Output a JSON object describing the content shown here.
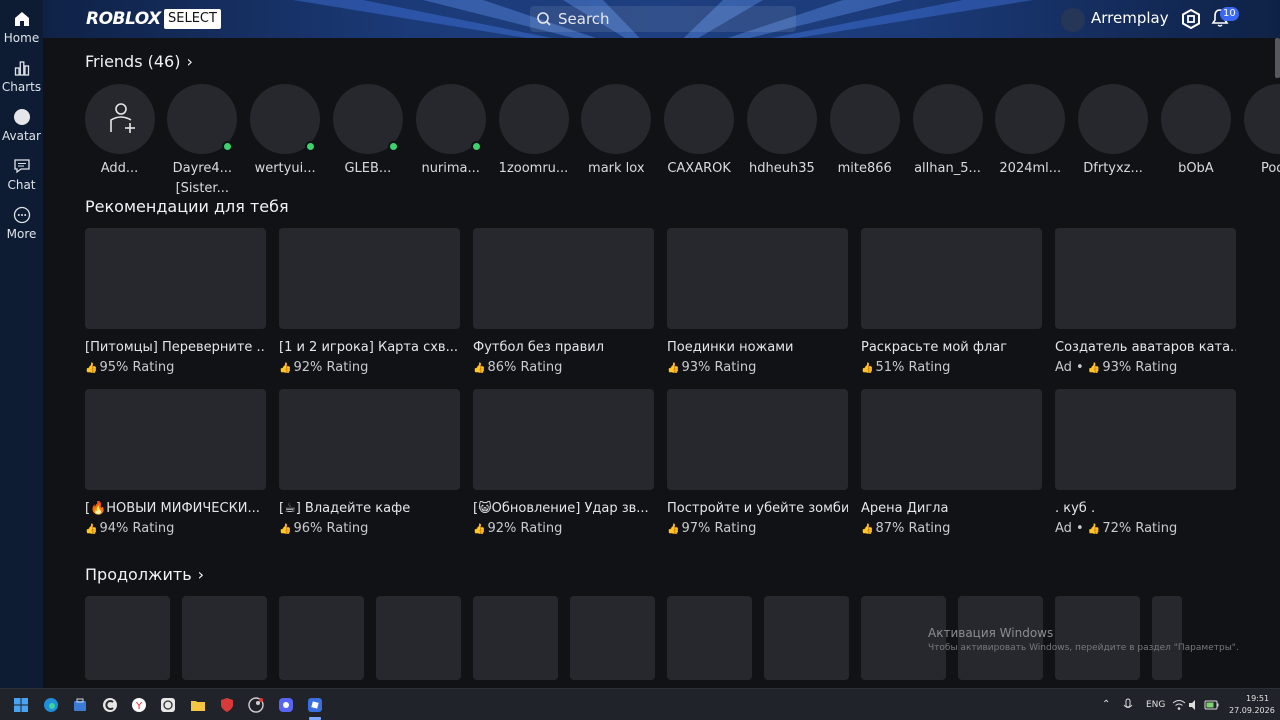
{
  "topbar": {
    "logo": "ROBLOX",
    "logo_badge": "SELECT",
    "search_label": "Search",
    "username": "Arremplay",
    "notifications_count": "10"
  },
  "sidebar": {
    "items": [
      {
        "label": "Home",
        "icon": "home-icon"
      },
      {
        "label": "Charts",
        "icon": "charts-icon"
      },
      {
        "label": "Avatar",
        "icon": "avatar-icon"
      },
      {
        "label": "Chat",
        "icon": "chat-icon"
      },
      {
        "label": "More",
        "icon": "more-icon"
      }
    ]
  },
  "friends": {
    "title": "Friends (46)",
    "items": [
      {
        "name": "Add...",
        "online": false,
        "add": true
      },
      {
        "name": "Dayre4...",
        "status": "[Sister...",
        "online": true
      },
      {
        "name": "wertyui...",
        "online": true
      },
      {
        "name": "GLEB...",
        "online": true
      },
      {
        "name": "nurima...",
        "online": true
      },
      {
        "name": "1zoomru...",
        "online": false
      },
      {
        "name": "mark lox",
        "online": false
      },
      {
        "name": "CAXAROK",
        "online": false
      },
      {
        "name": "hdheuh35",
        "online": false
      },
      {
        "name": "mite866",
        "online": false
      },
      {
        "name": "allhan_5...",
        "online": false
      },
      {
        "name": "2024ml...",
        "online": false
      },
      {
        "name": "Dfrtyxz...",
        "online": false
      },
      {
        "name": "bObA",
        "online": false
      },
      {
        "name": "Podst",
        "online": false
      }
    ]
  },
  "recommended": {
    "title": "Рекомендации для тебя",
    "games": [
      {
        "title": "[Питомцы] Переверните ...",
        "rating": "95% Rating",
        "ad": ""
      },
      {
        "title": "[1 и 2 игрока] Карта схв...",
        "rating": "92% Rating",
        "ad": ""
      },
      {
        "title": "Футбол без правил",
        "rating": "86% Rating",
        "ad": ""
      },
      {
        "title": "Поединки ножами",
        "rating": "93% Rating",
        "ad": ""
      },
      {
        "title": "Раскрасьте мой флаг",
        "rating": "51% Rating",
        "ad": ""
      },
      {
        "title": "Создатель аватаров ката...",
        "rating": "93% Rating",
        "ad": "Ad •"
      },
      {
        "title": "[🔥НОВЫЙ МИФИЧЕСКИ...",
        "rating": "94% Rating",
        "ad": ""
      },
      {
        "title": "[☕] Владейте кафе",
        "rating": "96% Rating",
        "ad": ""
      },
      {
        "title": "[😺Обновление] Удар зв...",
        "rating": "92% Rating",
        "ad": ""
      },
      {
        "title": "Постройте и убейте зомби",
        "rating": "97% Rating",
        "ad": ""
      },
      {
        "title": "Арена Дигла",
        "rating": "87% Rating",
        "ad": ""
      },
      {
        "title": ". куб .",
        "rating": "72% Rating",
        "ad": "Ad •"
      }
    ]
  },
  "continue": {
    "title": "Продолжить"
  },
  "watermark": {
    "line1": "Активация Windows",
    "line2": "Чтобы активировать Windows, перейдите в раздел \"Параметры\"."
  },
  "taskbar": {
    "lang": "ENG",
    "time": "19:51",
    "date": "27.09.2026"
  },
  "colors": {
    "online": "#3dd26d",
    "accent": "#3b67f5",
    "sidebar": "#0d1c33"
  }
}
